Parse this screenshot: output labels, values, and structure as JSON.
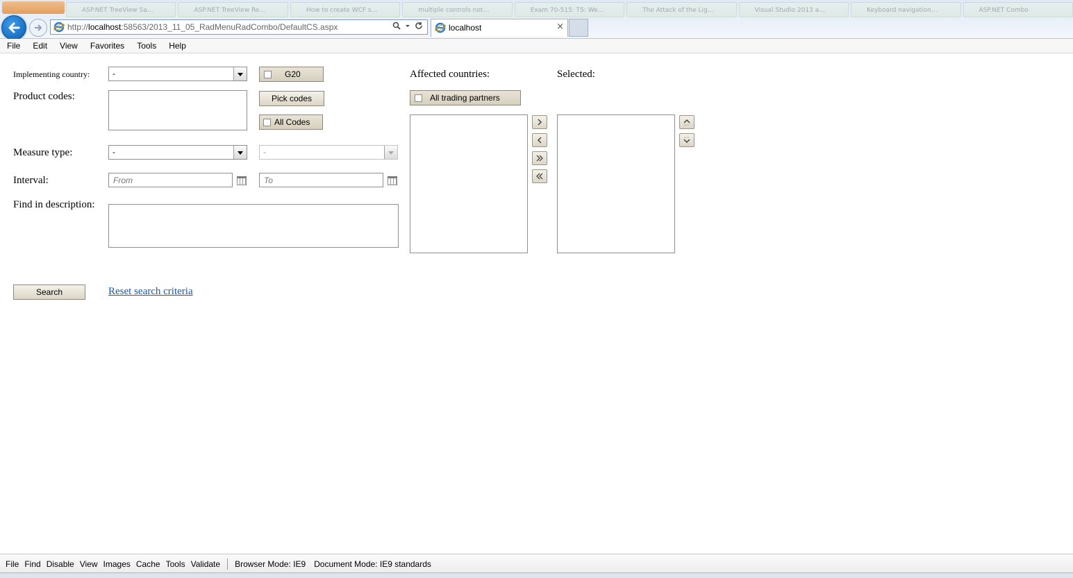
{
  "browser": {
    "url_prefix": "http://",
    "url_host": "localhost",
    "url_rest": ":58563/2013_11_05_RadMenuRadCombo/DefaultCS.aspx",
    "tab_title": "localhost",
    "tab_close_glyph": "×",
    "ghost_tabs": [
      "ASP.NET TreeView Sa…",
      "ASP.NET TreeView Re…",
      "How to create WCF s…",
      "multiple controls not…",
      "Exam 70-515: TS: We…",
      "The Attack of the Lig…",
      "Visual Studio 2013 a…",
      "Keyboard navigation…",
      "ASP.NET Combo"
    ]
  },
  "menubar": {
    "items": [
      "File",
      "Edit",
      "View",
      "Favorites",
      "Tools",
      "Help"
    ]
  },
  "form": {
    "implementing_country_label": "Implementing country:",
    "implementing_country_value": "-",
    "g20_label": "G20",
    "product_codes_label": "Product codes:",
    "pick_codes_label": "Pick codes",
    "all_codes_label": "All Codes",
    "measure_type_label": "Measure type:",
    "measure_type_value": "-",
    "measure_subtype_value": "-",
    "interval_label": "Interval:",
    "from_placeholder": "From",
    "to_placeholder": "To",
    "find_desc_label": "Find in description:",
    "search_label": "Search",
    "reset_label": "Reset search criteria"
  },
  "countries": {
    "affected_label": "Affected countries:",
    "selected_label": "Selected:",
    "all_partners_label": "All trading partners"
  },
  "devbar": {
    "items": [
      "File",
      "Find",
      "Disable",
      "View",
      "Images",
      "Cache",
      "Tools",
      "Validate"
    ],
    "browser_mode_label": "Browser Mode:",
    "browser_mode_value": "IE9",
    "document_mode_label": "Document Mode:",
    "document_mode_value": "IE9 standards"
  }
}
